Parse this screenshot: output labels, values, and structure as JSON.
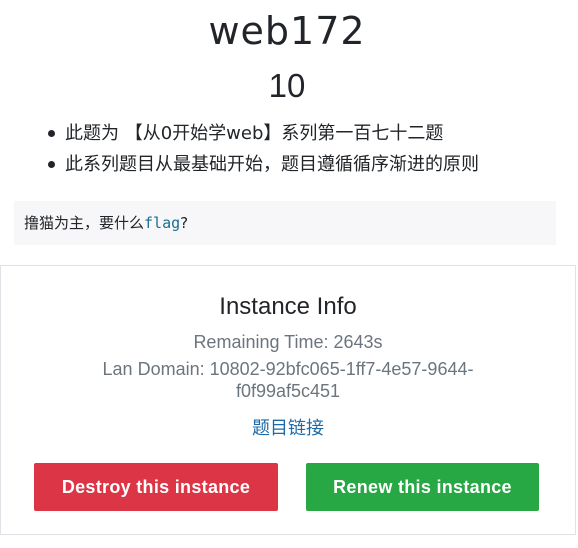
{
  "challenge": {
    "title": "web172",
    "points": "10",
    "description_items": [
      "此题为 【从0开始学web】系列第一百七十二题",
      "此系列题目从最基础开始，题目遵循循序渐进的原则"
    ],
    "hint_prefix": "撸猫为主，要什么",
    "hint_code": "flag",
    "hint_suffix": "?"
  },
  "instance": {
    "heading": "Instance Info",
    "remaining_time": "Remaining Time: 2643s",
    "lan_domain": "Lan Domain: 10802-92bfc065-1ff7-4e57-9644-f0f99af5c451",
    "link_label": "题目链接",
    "destroy_label": "Destroy this instance",
    "renew_label": "Renew this instance"
  },
  "colors": {
    "destroy_button": "#dc3545",
    "renew_button": "#28a745",
    "link": "#1e6aa8",
    "code": "#1a6e8f",
    "muted_text": "#6c757d"
  }
}
